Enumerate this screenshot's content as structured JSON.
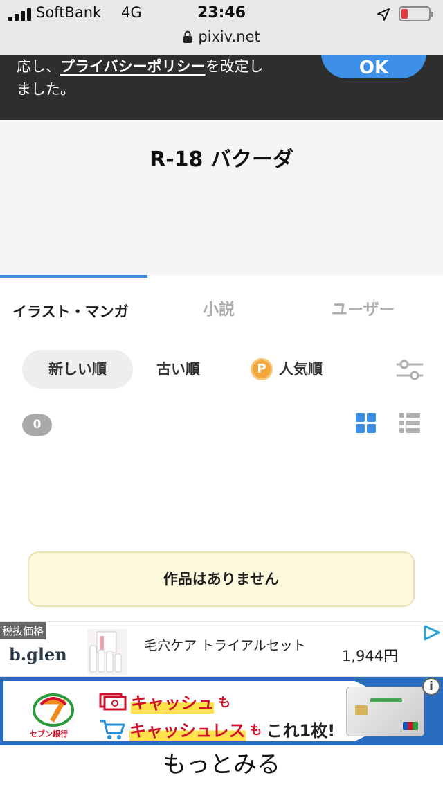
{
  "status_bar": {
    "carrier": "SoftBank",
    "network": "4G",
    "time": "23:46",
    "url": "pixiv.net"
  },
  "banner": {
    "text_prefix": "応し、",
    "link_text": "プライバシーポリシー",
    "text_mid": "を改定し",
    "text_line2": "ました。",
    "ok_label": "OK"
  },
  "tag": {
    "title": "R-18 バクーダ"
  },
  "tabs": [
    {
      "label": "イラスト・マンガ",
      "active": true
    },
    {
      "label": "小説",
      "active": false
    },
    {
      "label": "ユーザー",
      "active": false
    }
  ],
  "sort": {
    "newest": "新しい順",
    "oldest": "古い順",
    "popular": "人気順",
    "premium_badge": "P"
  },
  "results": {
    "count": "0",
    "empty_message": "作品はありません"
  },
  "ad1": {
    "tax_label": "税抜価格",
    "brand": "b.glen",
    "title": "毛穴ケア トライアルセット",
    "price": "1,944円"
  },
  "ad2": {
    "line1_main": "キャッシュ",
    "line1_suffix": "も",
    "line2_main": "キャッシュレス",
    "line2_mid": "も",
    "line2_end": "これ1枚!",
    "bank_name": "セブン銀行"
  },
  "more_label": "もっとみる",
  "colors": {
    "accent": "#3d8fe8",
    "banner_bg": "#2e2e2e",
    "notice_bg": "#fdf9dc",
    "premium": "#f3a63b"
  }
}
